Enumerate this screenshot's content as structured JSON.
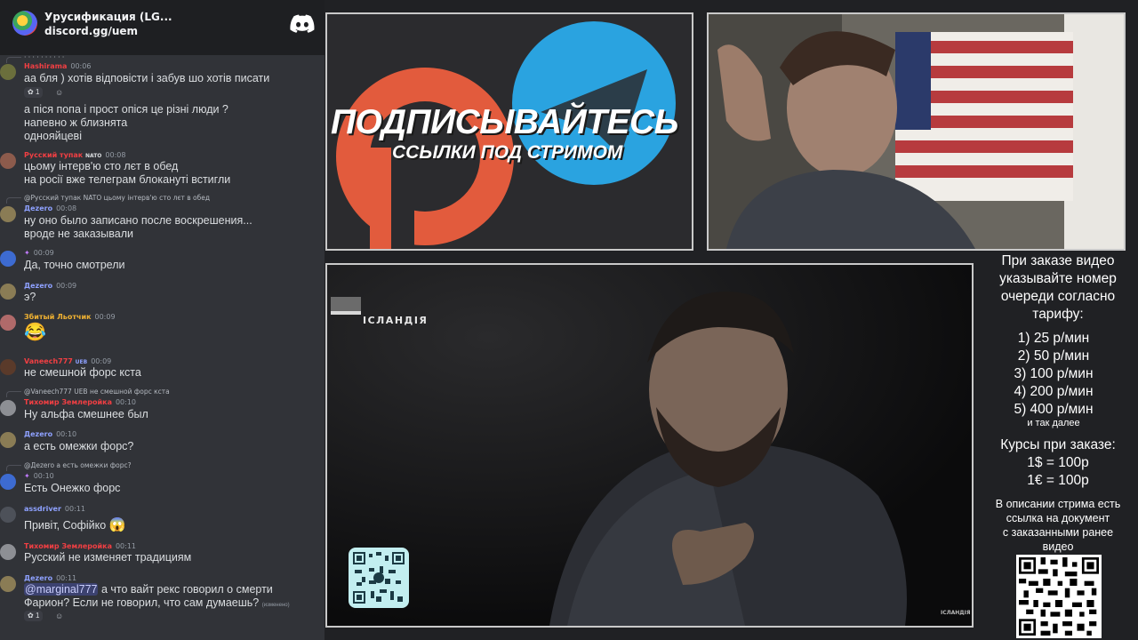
{
  "chat": {
    "server_title": "Урусификация (LG...",
    "invite": "discord.gg/uem",
    "messages": [
      {
        "name": "Hashirama",
        "time": "00:06",
        "lines": [
          "аа бля ) хотів відповісти і забув шо хотів писати"
        ],
        "reaction": "1"
      },
      {
        "lines": [
          "а піся попа і прост опіся це різні люди ?",
          "напевно ж близнята",
          "однояйцеві"
        ]
      },
      {
        "name": "Русский тупак",
        "badge": "NATO",
        "time": "00:08",
        "lines": [
          "цьому інтерв'ю сто лєт в обед",
          "на росії вже телеграм блокануті встигли"
        ]
      },
      {
        "reply": "@Русский тупак NATO цьому інтерв'ю сто лєт в обед",
        "name": "Дezero",
        "time": "00:08",
        "lines": [
          "ну оно было записано после воскрешения...",
          "вроде не заказывали"
        ]
      },
      {
        "time": "00:09",
        "lines": [
          "Да, точно смотрели"
        ]
      },
      {
        "name": "Дezero",
        "time": "00:09",
        "lines": [
          "э?"
        ]
      },
      {
        "name": "Збитый Льотчик",
        "time": "00:09",
        "emoji": "😂"
      },
      {
        "name": "Vaneech777",
        "badge": "UEB",
        "time": "00:09",
        "lines": [
          "не смешной форс кста"
        ]
      },
      {
        "reply": "@Vaneech777 UEB не смешной форс кста",
        "name": "Тихомир Землеройка",
        "time": "00:10",
        "lines": [
          "Ну альфа смешнее был"
        ]
      },
      {
        "name": "Дezero",
        "time": "00:10",
        "lines": [
          "а есть омежки форс?"
        ]
      },
      {
        "reply": "@Дezero а есть омежки форс?",
        "time": "00:10",
        "lines": [
          "Есть Онежко форс"
        ]
      },
      {
        "name": "assdriver",
        "time": "00:11",
        "lines": [
          "Привіт, Софійко"
        ]
      },
      {
        "name": "Тихомир Землеройка",
        "time": "00:11",
        "lines": [
          "Русский не изменяет традициям"
        ]
      },
      {
        "name": "Дezero",
        "time": "00:11",
        "mention": "@marginal777",
        "lines": [
          "а что вайт рекс говорил о смерти",
          "Фарион? Если не говорил, что сам думаешь?"
        ],
        "edited": "(изменено)",
        "reaction": "1"
      }
    ]
  },
  "promo": {
    "headline": "ПОДПИСЫВАЙТЕСЬ",
    "sub": "ССЫЛКИ ПОД СТРИМОМ"
  },
  "video": {
    "location": "ІСЛАНДІЯ",
    "watermark": "ІСЛАНДІЯ"
  },
  "info": {
    "heading": [
      "При заказе видео",
      "указывайте номер",
      "очереди согласно",
      "тарифу:"
    ],
    "tariffs": [
      "1) 25 р/мин",
      "2) 50 р/мин",
      "3) 100 р/мин",
      "4) 200 р/мин",
      "5) 400 р/мин"
    ],
    "etc": "и так далее",
    "rates_title": "Курсы при заказе:",
    "rates": [
      "1$ = 100р",
      "1€ = 100р"
    ],
    "desc": [
      "В описании стрима есть",
      "ссылка на документ",
      "с заказанными ранее",
      "видео"
    ]
  },
  "colors": {
    "chat_bg": "#313338",
    "header_bg": "#1e1f22",
    "discord_blurple": "#5865f2",
    "patreon_orange": "#e25b3d",
    "telegram_blue": "#2aa3e0",
    "name_red": "#f23f43",
    "name_blue": "#8ea1ff",
    "name_yellow": "#f0b232"
  }
}
